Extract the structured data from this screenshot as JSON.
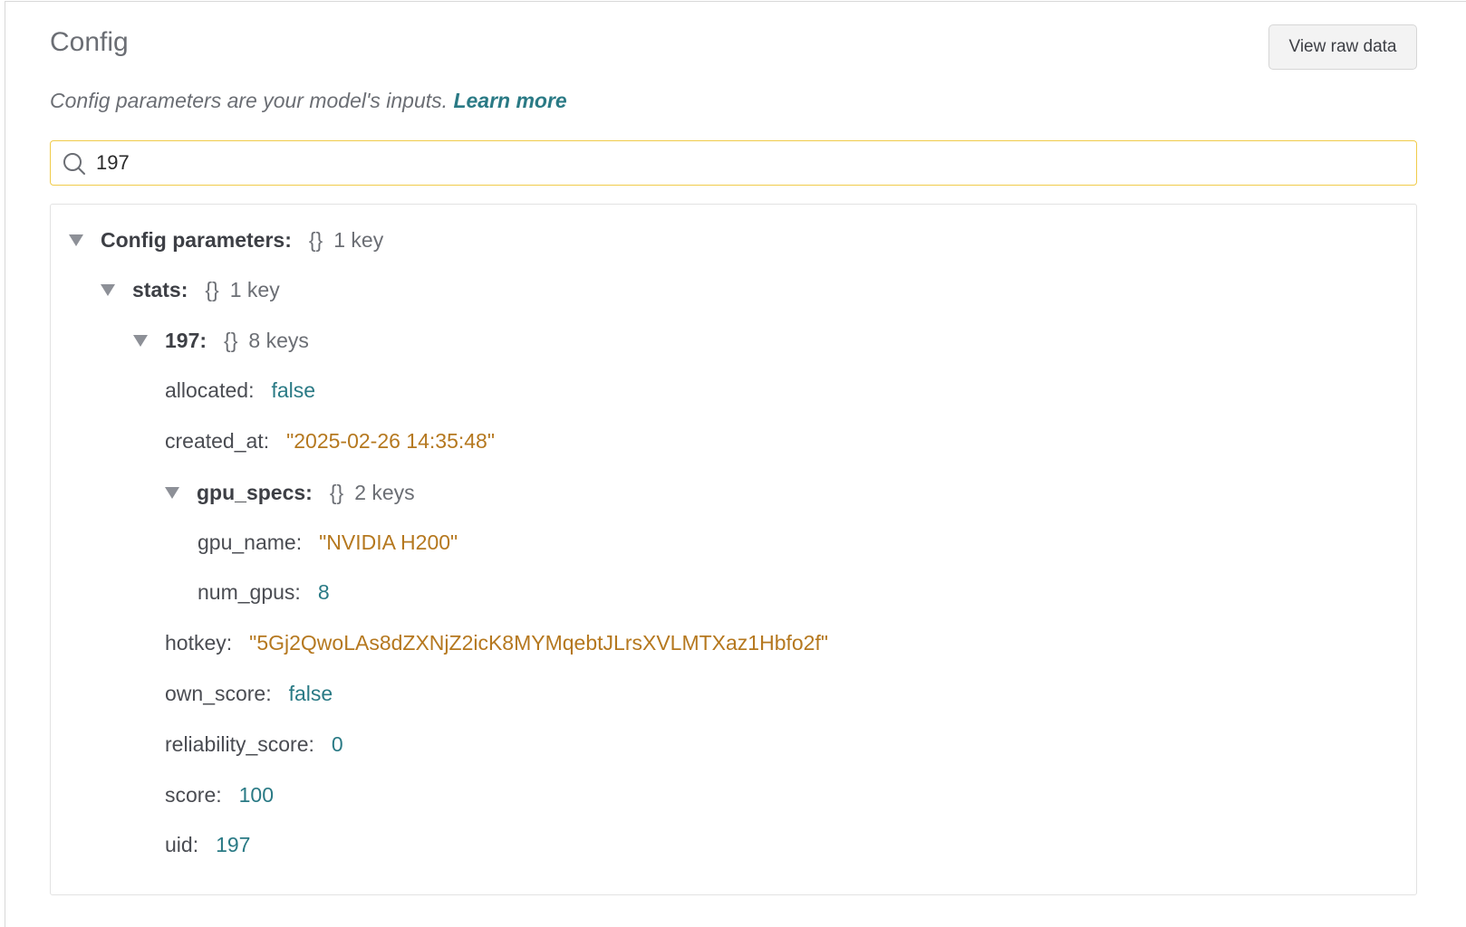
{
  "header": {
    "title": "Config",
    "view_raw_label": "View raw data",
    "subtitle": "Config parameters are your model's inputs.",
    "learn_more": "Learn more"
  },
  "search": {
    "value": "197",
    "icon": "search-icon"
  },
  "tree": {
    "root": {
      "label": "Config parameters:",
      "braces": "{}",
      "count": "1 key"
    },
    "stats": {
      "label": "stats:",
      "braces": "{}",
      "count": "1 key"
    },
    "entry": {
      "label": "197:",
      "braces": "{}",
      "count": "8 keys"
    },
    "allocated": {
      "key": "allocated:",
      "value": "false"
    },
    "created_at": {
      "key": "created_at:",
      "value": "\"2025-02-26 14:35:48\""
    },
    "gpu_specs": {
      "label": "gpu_specs:",
      "braces": "{}",
      "count": "2 keys"
    },
    "gpu_name": {
      "key": "gpu_name:",
      "value": "\"NVIDIA H200\""
    },
    "num_gpus": {
      "key": "num_gpus:",
      "value": "8"
    },
    "hotkey": {
      "key": "hotkey:",
      "value": "\"5Gj2QwoLAs8dZXNjZ2icK8MYMqebtJLrsXVLMTXaz1Hbfo2f\""
    },
    "own_score": {
      "key": "own_score:",
      "value": "false"
    },
    "reliability_score": {
      "key": "reliability_score:",
      "value": "0"
    },
    "score": {
      "key": "score:",
      "value": "100"
    },
    "uid": {
      "key": "uid:",
      "value": "197"
    }
  },
  "colors": {
    "accent_link": "#2a7a85",
    "string_value": "#b5781f",
    "search_border": "#f0cb4a"
  }
}
